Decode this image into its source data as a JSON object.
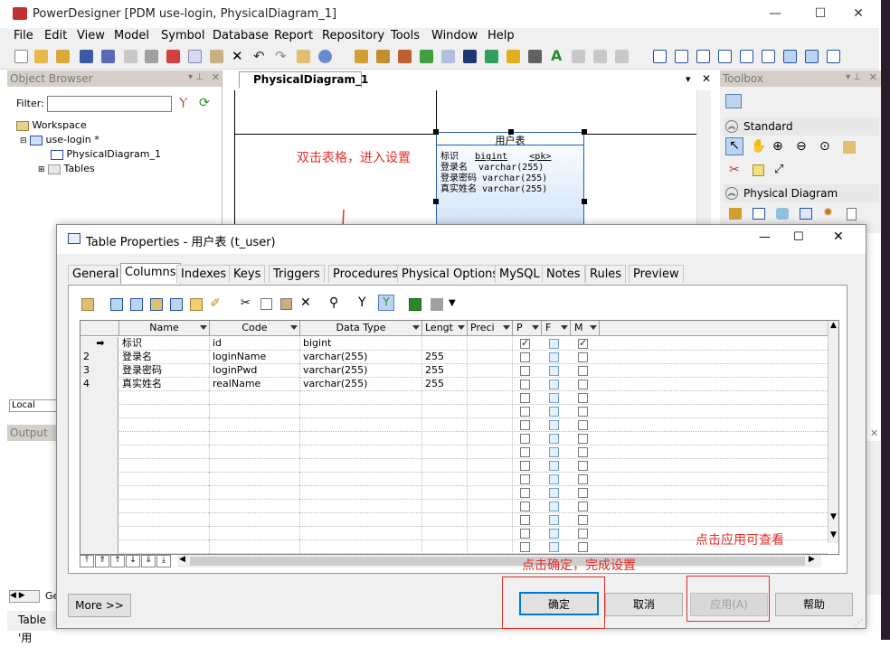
{
  "app": {
    "title": "PowerDesigner [PDM use-login, PhysicalDiagram_1]"
  },
  "menu": [
    "File",
    "Edit",
    "View",
    "Model",
    "Symbol",
    "Database",
    "Report",
    "Repository",
    "Tools",
    "Window",
    "Help"
  ],
  "object_browser": {
    "header": "Object Browser",
    "filter_label": "Filter:",
    "tree": [
      "Workspace",
      "use-login *",
      "PhysicalDiagram_1",
      "Tables"
    ],
    "local_tab": "Local"
  },
  "diagram": {
    "tab": "PhysicalDiagram_1",
    "table_title": "用户表",
    "entity_rows": [
      {
        "name": "标识",
        "type": "bigint",
        "key": "<pk>"
      },
      {
        "name": "登录名",
        "type": "varchar(255)",
        "key": ""
      },
      {
        "name": "登录密码",
        "type": "varchar(255)",
        "key": ""
      },
      {
        "name": "真实姓名",
        "type": "varchar(255)",
        "key": ""
      }
    ]
  },
  "toolbox": {
    "header": "Toolbox",
    "standard": "Standard",
    "physical": "Physical Diagram"
  },
  "output": {
    "header": "Output"
  },
  "status": {
    "text": "Table '用"
  },
  "left_tab": "Ge",
  "dialog": {
    "title": "Table Properties - 用户表 (t_user)",
    "tabs": [
      "General",
      "Columns",
      "Indexes",
      "Keys",
      "Triggers",
      "Procedures",
      "Physical Options",
      "MySQL",
      "Notes",
      "Rules",
      "Preview"
    ],
    "grid_headers": [
      "Name",
      "Code",
      "Data Type",
      "Lengt",
      "Preci",
      "P",
      "F",
      "M"
    ],
    "rows": [
      {
        "num": "➡",
        "name": "标识",
        "code": "id",
        "type": "bigint",
        "len": "",
        "p": true,
        "m": true
      },
      {
        "num": "2",
        "name": "登录名",
        "code": "loginName",
        "type": "varchar(255)",
        "len": "255",
        "p": false,
        "m": false
      },
      {
        "num": "3",
        "name": "登录密码",
        "code": "loginPwd",
        "type": "varchar(255)",
        "len": "255",
        "p": false,
        "m": false
      },
      {
        "num": "4",
        "name": "真实姓名",
        "code": "realName",
        "type": "varchar(255)",
        "len": "255",
        "p": false,
        "m": false
      }
    ],
    "buttons": {
      "more": "More >>",
      "ok": "确定",
      "cancel": "取消",
      "apply": "应用(A)",
      "help": "帮助"
    }
  },
  "annotations": {
    "dblclick": "双击表格，进入设置",
    "apply_hint": "点击应用可查看",
    "ok_hint": "点击确定，完成设置"
  },
  "colors": {
    "annotation": "#e0302a",
    "accent": "#0078d7"
  }
}
